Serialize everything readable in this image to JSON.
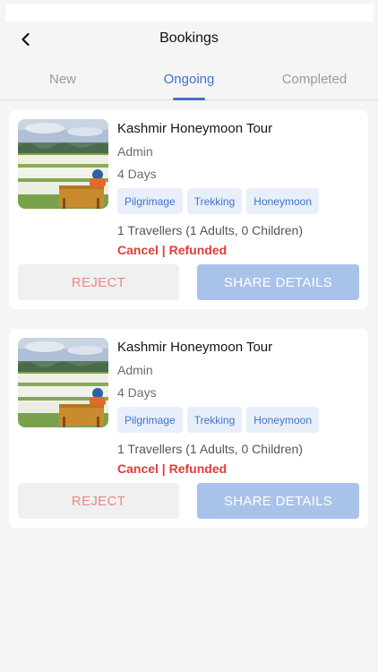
{
  "header": {
    "title": "Bookings"
  },
  "tabs": [
    {
      "label": "New",
      "active": false
    },
    {
      "label": "Ongoing",
      "active": true
    },
    {
      "label": "Completed",
      "active": false
    }
  ],
  "bookings": [
    {
      "tour_name": "Kashmir Honeymoon Tour",
      "organizer": "Admin",
      "duration": "4 Days",
      "tags": [
        "Pilgrimage",
        "Trekking",
        "Honeymoon"
      ],
      "travellers": "1 Travellers",
      "travellers_detail": "(1 Adults, 0 Children)",
      "status": "Cancel | Refunded",
      "reject_label": "REJECT",
      "share_label": "SHARE DETAILS"
    },
    {
      "tour_name": "Kashmir Honeymoon Tour",
      "organizer": "Admin",
      "duration": "4 Days",
      "tags": [
        "Pilgrimage",
        "Trekking",
        "Honeymoon"
      ],
      "travellers": "1 Travellers",
      "travellers_detail": "(1 Adults, 0 Children)",
      "status": "Cancel | Refunded",
      "reject_label": "REJECT",
      "share_label": "SHARE DETAILS"
    }
  ],
  "colors": {
    "accent": "#3f74c9",
    "status_red": "#e23b3b",
    "chip_bg": "#e8effa",
    "share_button": "#a9c2e9",
    "reject_button": "#f0f0f0"
  },
  "icons": {
    "back": "chevron-left-icon"
  }
}
